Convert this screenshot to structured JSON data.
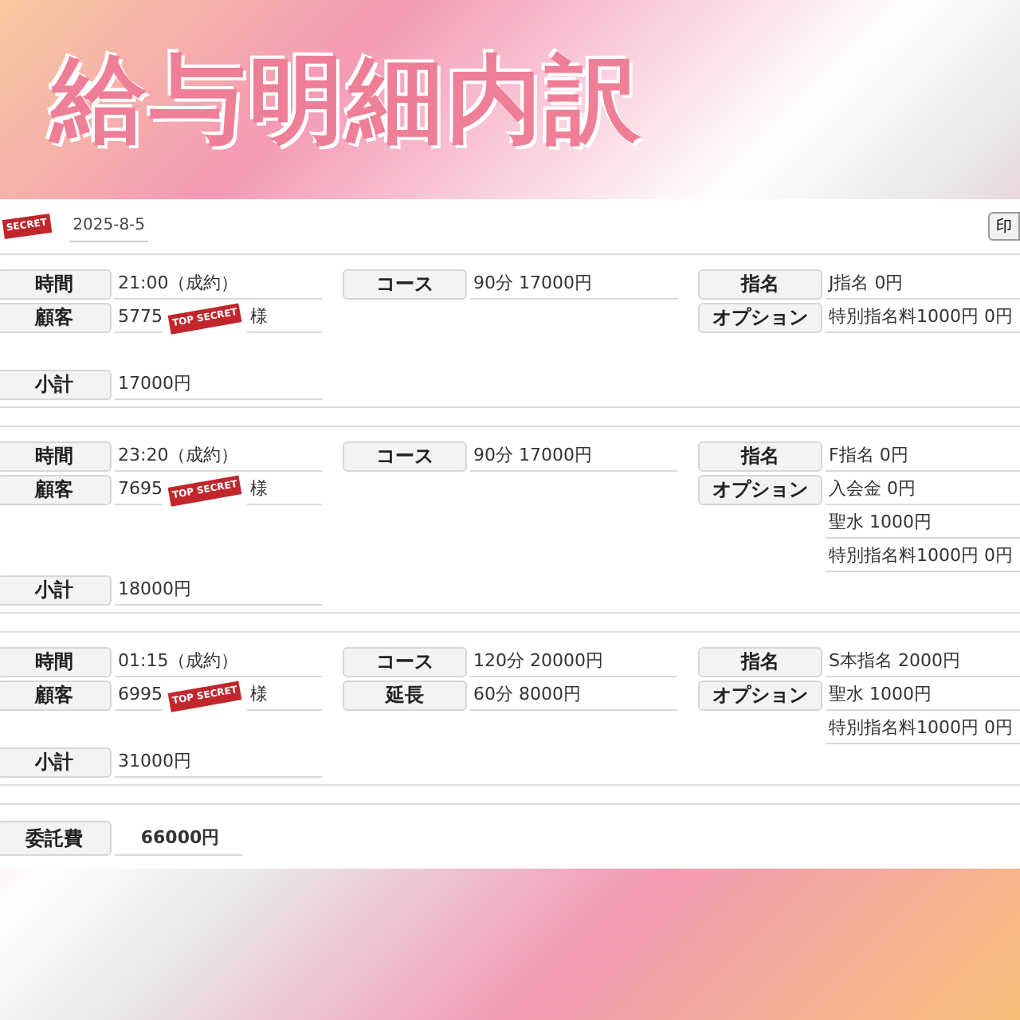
{
  "title": "給与明細内訳",
  "header": {
    "date": "2025-8-5",
    "print_button": "印",
    "stamp": "SECRET"
  },
  "sessions": [
    {
      "time": {
        "label": "時間",
        "value": "21:00（成約）"
      },
      "customer": {
        "label": "顧客",
        "value": "5775",
        "suffix": "様",
        "stamp": "TOP SECRET"
      },
      "subtotal": {
        "label": "小計",
        "value": "17000円"
      },
      "course": [
        {
          "label": "コース",
          "value": "90分 17000円"
        }
      ],
      "nomination": {
        "label": "指名",
        "value": "J指名 0円"
      },
      "options": {
        "label": "オプション",
        "values": [
          "特別指名料1000円 0円"
        ]
      }
    },
    {
      "time": {
        "label": "時間",
        "value": "23:20（成約）"
      },
      "customer": {
        "label": "顧客",
        "value": "7695",
        "suffix": "様",
        "stamp": "TOP SECRET"
      },
      "subtotal": {
        "label": "小計",
        "value": "18000円"
      },
      "course": [
        {
          "label": "コース",
          "value": "90分 17000円"
        }
      ],
      "nomination": {
        "label": "指名",
        "value": "F指名 0円"
      },
      "options": {
        "label": "オプション",
        "values": [
          "入会金 0円",
          "聖水 1000円",
          "特別指名料1000円 0円"
        ]
      }
    },
    {
      "time": {
        "label": "時間",
        "value": "01:15（成約）"
      },
      "customer": {
        "label": "顧客",
        "value": "6995",
        "suffix": "様",
        "stamp": "TOP SECRET"
      },
      "subtotal": {
        "label": "小計",
        "value": "31000円"
      },
      "course": [
        {
          "label": "コース",
          "value": "120分 20000円"
        },
        {
          "label": "延長",
          "value": "60分 8000円"
        }
      ],
      "nomination": {
        "label": "指名",
        "value": "S本指名 2000円"
      },
      "options": {
        "label": "オプション",
        "values": [
          "聖水 1000円",
          "特別指名料1000円 0円"
        ]
      }
    }
  ],
  "total": {
    "label": "委託費",
    "value": "66000円"
  }
}
